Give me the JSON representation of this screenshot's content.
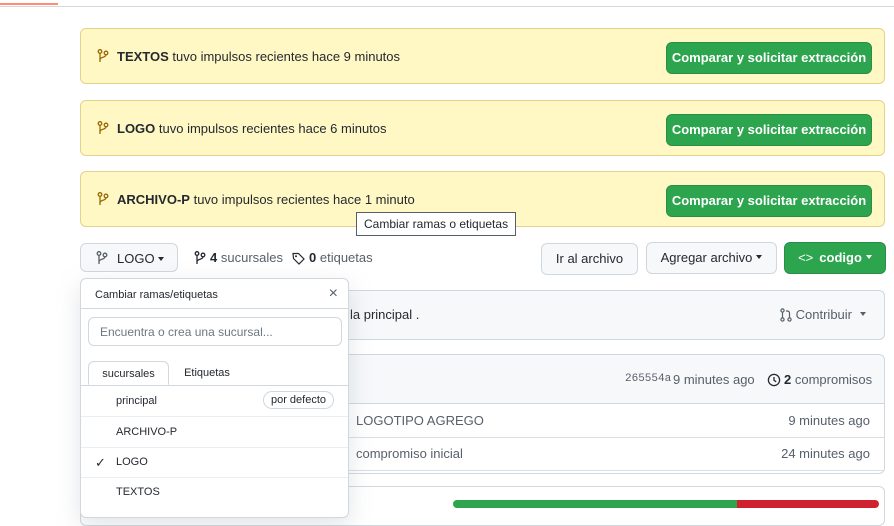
{
  "banners": [
    {
      "branch": "TEXTOS",
      "text": "tuvo impulsos recientes hace 9 minutos",
      "button": "Comparar y solicitar extracción"
    },
    {
      "branch": "LOGO",
      "text": "tuvo impulsos recientes hace 6 minutos",
      "button": "Comparar y solicitar extracción"
    },
    {
      "branch": "ARCHIVO-P",
      "text": "tuvo impulsos recientes hace 1 minuto",
      "button": "Comparar y solicitar extracción"
    }
  ],
  "tooltip": "Cambiar ramas o etiquetas",
  "toolbar": {
    "branch_label": "LOGO",
    "branches_count": "4",
    "branches_label": "sucursales",
    "tags_count": "0",
    "tags_label": "etiquetas",
    "go_to_file": "Ir al archivo",
    "add_file": "Agregar archivo",
    "code": "codigo"
  },
  "compare_panel": {
    "text": "la principal .",
    "contribute": "Contribuir"
  },
  "commit_panel": {
    "sha": "265554a",
    "time": "9 minutes ago",
    "commits_count": "2",
    "commits_label": "compromisos",
    "rows": [
      {
        "message": "LOGOTIPO AGREGO",
        "time": "9 minutes ago"
      },
      {
        "message": "compromiso inicial",
        "time": "24 minutes ago"
      }
    ]
  },
  "dropdown": {
    "title": "Cambiar ramas/etiquetas",
    "close": "×",
    "search_placeholder": "Encuentra o crea una sucursal...",
    "tabs": [
      "sucursales",
      "Etiquetas"
    ],
    "items": [
      {
        "name": "principal",
        "badge": "por defecto",
        "checked": false
      },
      {
        "name": "ARCHIVO-P",
        "checked": false
      },
      {
        "name": "LOGO",
        "checked": true
      },
      {
        "name": "TEXTOS",
        "checked": false
      }
    ],
    "check_glyph": "✓"
  },
  "colors": {
    "accent": "#fd8c73",
    "green": "#2da44e",
    "banner_bg": "#fff8c5",
    "red": "#cf222e"
  }
}
